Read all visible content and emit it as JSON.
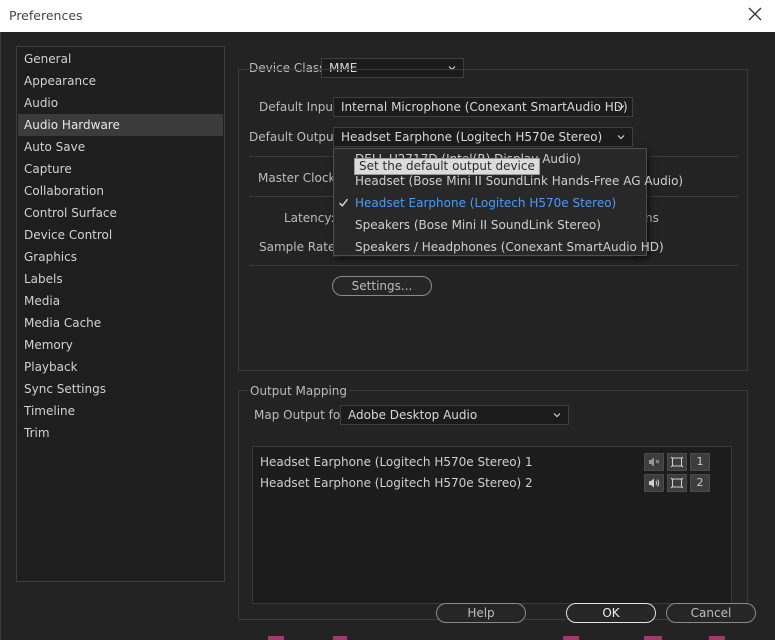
{
  "window": {
    "title": "Preferences"
  },
  "sidebar": {
    "items": [
      {
        "label": "General"
      },
      {
        "label": "Appearance"
      },
      {
        "label": "Audio"
      },
      {
        "label": "Audio Hardware",
        "selected": true
      },
      {
        "label": "Auto Save"
      },
      {
        "label": "Capture"
      },
      {
        "label": "Collaboration"
      },
      {
        "label": "Control Surface"
      },
      {
        "label": "Device Control"
      },
      {
        "label": "Graphics"
      },
      {
        "label": "Labels"
      },
      {
        "label": "Media"
      },
      {
        "label": "Media Cache"
      },
      {
        "label": "Memory"
      },
      {
        "label": "Playback"
      },
      {
        "label": "Sync Settings"
      },
      {
        "label": "Timeline"
      },
      {
        "label": "Trim"
      }
    ]
  },
  "hardware": {
    "device_class_label": "Device Class:",
    "device_class_value": "MME",
    "default_input_label": "Default Input:",
    "default_input_value": "Internal Microphone (Conexant SmartAudio HD)",
    "default_output_label": "Default Output:",
    "default_output_value": "Headset Earphone (Logitech H570e Stereo)",
    "master_clock_label": "Master Clock:",
    "latency_label": "Latency:",
    "latency_unit_fragment": "ns",
    "sample_rate_label": "Sample Rate:",
    "settings_button": "Settings..."
  },
  "output_menu": {
    "items": [
      {
        "label": "DELL U2717D (Intel(R) Display Audio)"
      },
      {
        "label": "Headset (Bose Mini II SoundLink Hands-Free AG Audio)"
      },
      {
        "label": "Headset Earphone (Logitech H570e Stereo)",
        "checked": true
      },
      {
        "label": "Speakers (Bose Mini II SoundLink Stereo)"
      },
      {
        "label": "Speakers / Headphones (Conexant SmartAudio HD)"
      }
    ],
    "tooltip": "Set the default output device"
  },
  "output_mapping": {
    "group_label": "Output Mapping",
    "map_output_label": "Map Output for:",
    "map_output_value": "Adobe Desktop Audio",
    "channels": [
      {
        "label": "Headset Earphone (Logitech H570e Stereo) 1",
        "number": "1"
      },
      {
        "label": "Headset Earphone (Logitech H570e Stereo) 2",
        "number": "2"
      }
    ]
  },
  "footer": {
    "help": "Help",
    "ok": "OK",
    "cancel": "Cancel"
  },
  "colors": {
    "background": "#232323",
    "accent_checked": "#4a9aff",
    "titlebar": "#ffffff"
  }
}
